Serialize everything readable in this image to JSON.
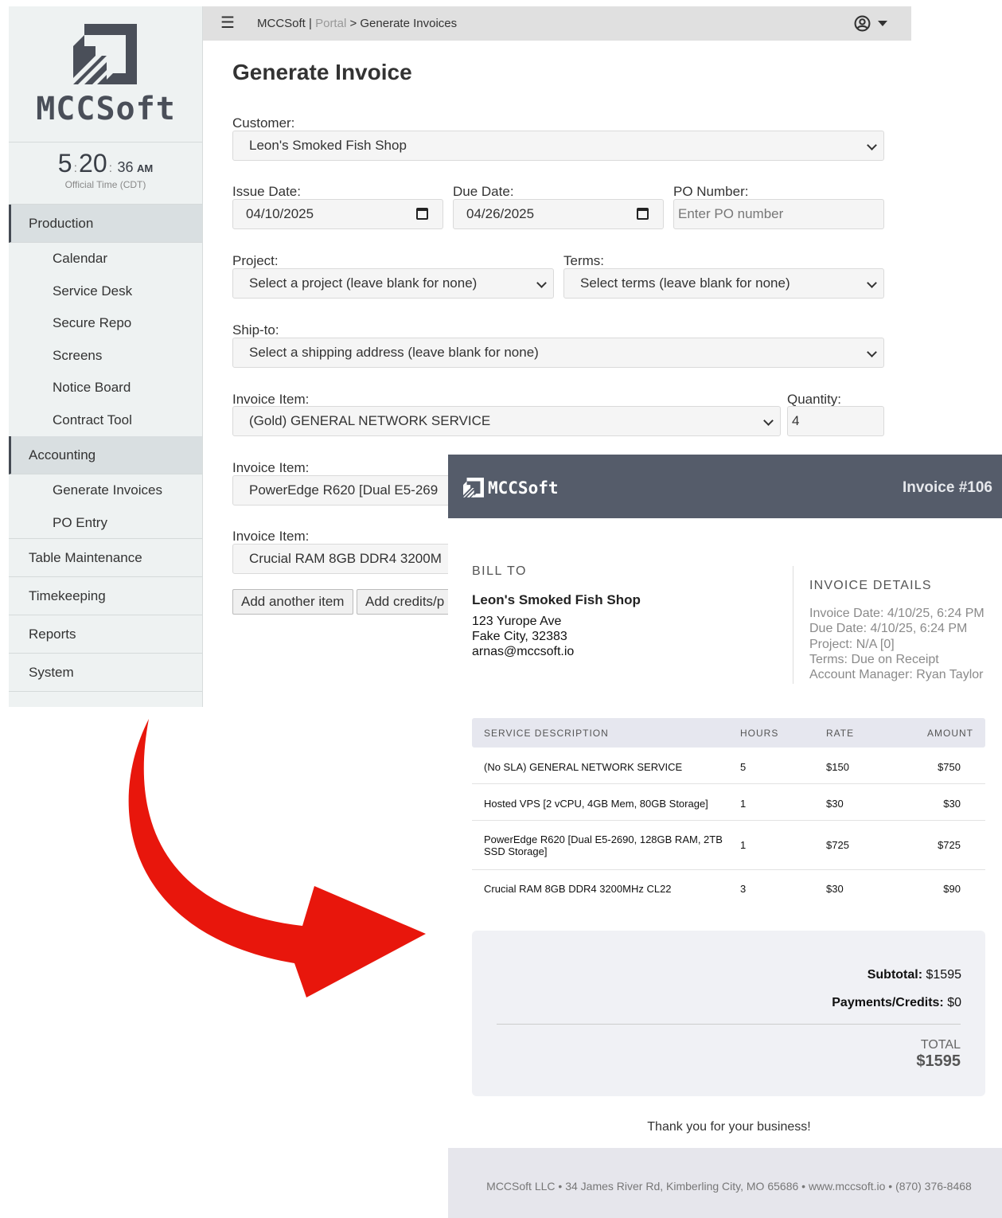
{
  "app": {
    "logo_text": "MCCSoft",
    "clock": {
      "hour": "5",
      "minute": "20",
      "second": "36",
      "ampm": "AM",
      "subtitle": "Official Time (CDT)"
    },
    "sidebar": [
      {
        "label": "Production",
        "active": true,
        "children": [
          "Calendar",
          "Service Desk",
          "Secure Repo",
          "Screens",
          "Notice Board",
          "Contract Tool"
        ]
      },
      {
        "label": "Accounting",
        "active": true,
        "children": [
          "Generate Invoices",
          "PO Entry"
        ]
      },
      {
        "label": "Table Maintenance"
      },
      {
        "label": "Timekeeping"
      },
      {
        "label": "Reports"
      },
      {
        "label": "System"
      }
    ],
    "topbar": {
      "hamburger_icon": "menu-icon",
      "brand": "MCCSoft",
      "separator": "|",
      "portal": "Portal",
      "crumb_sep": ">",
      "current_page": "Generate Invoices",
      "user_icon": "user-circle-icon"
    },
    "form": {
      "title": "Generate Invoice",
      "customer_label": "Customer:",
      "customer_value": "Leon's Smoked Fish Shop",
      "issue_date_label": "Issue Date:",
      "issue_date_value": "04/10/2025",
      "due_date_label": "Due Date:",
      "due_date_value": "04/26/2025",
      "po_label": "PO Number:",
      "po_placeholder": "Enter PO number",
      "project_label": "Project:",
      "project_value": "Select a project (leave blank for none)",
      "terms_label": "Terms:",
      "terms_value": "Select terms (leave blank for none)",
      "shipto_label": "Ship-to:",
      "shipto_value": "Select a shipping address (leave blank for none)",
      "items": [
        {
          "label": "Invoice Item:",
          "value": "(Gold) GENERAL NETWORK SERVICE",
          "qty_label": "Quantity:",
          "qty": "4"
        },
        {
          "label": "Invoice Item:",
          "value": "PowerEdge R620 [Dual E5-269"
        },
        {
          "label": "Invoice Item:",
          "value": "Crucial RAM 8GB DDR4 3200M"
        }
      ],
      "add_item_button": "Add another item",
      "add_credits_button": "Add credits/p"
    }
  },
  "invoice": {
    "logo_text": "MCCSoft",
    "number": "Invoice #106",
    "bill_to": {
      "title": "BILL TO",
      "name": "Leon's Smoked Fish Shop",
      "address1": "123 Yurope Ave",
      "address2": "Fake City, 32383",
      "email": "arnas@mccsoft.io"
    },
    "details": {
      "title": "INVOICE DETAILS",
      "lines": [
        "Invoice Date: 4/10/25, 6:24 PM",
        "Due Date: 4/10/25, 6:24 PM",
        "Project: N/A [0]",
        "Terms: Due on Receipt",
        "Account Manager: Ryan Taylor"
      ]
    },
    "table": {
      "headers": [
        "SERVICE DESCRIPTION",
        "HOURS",
        "RATE",
        "AMOUNT"
      ],
      "rows": [
        {
          "desc": "(No SLA) GENERAL NETWORK SERVICE",
          "hours": "5",
          "rate": "$150",
          "amount": "$750"
        },
        {
          "desc": "Hosted VPS [2 vCPU, 4GB Mem, 80GB Storage]",
          "hours": "1",
          "rate": "$30",
          "amount": "$30"
        },
        {
          "desc": "PowerEdge R620 [Dual E5-2690, 128GB RAM, 2TB SSD Storage]",
          "hours": "1",
          "rate": "$725",
          "amount": "$725"
        },
        {
          "desc": "Crucial RAM 8GB DDR4 3200MHz CL22",
          "hours": "3",
          "rate": "$30",
          "amount": "$90"
        }
      ]
    },
    "totals": {
      "subtotal_label": "Subtotal:",
      "subtotal": "$1595",
      "payments_label": "Payments/Credits:",
      "payments": "$0",
      "total_label": "TOTAL",
      "total": "$1595"
    },
    "thanks": "Thank you for your business!",
    "footer": "MCCSoft LLC • 34 James River Rd, Kimberling City, MO 65686 • www.mccsoft.io • (870) 376-8468"
  },
  "colors": {
    "arrow": "#e8160c",
    "invoice_header": "#555c6a",
    "sidebar_bg": "#eef2f2",
    "topbar_bg": "#e0e0e0"
  }
}
